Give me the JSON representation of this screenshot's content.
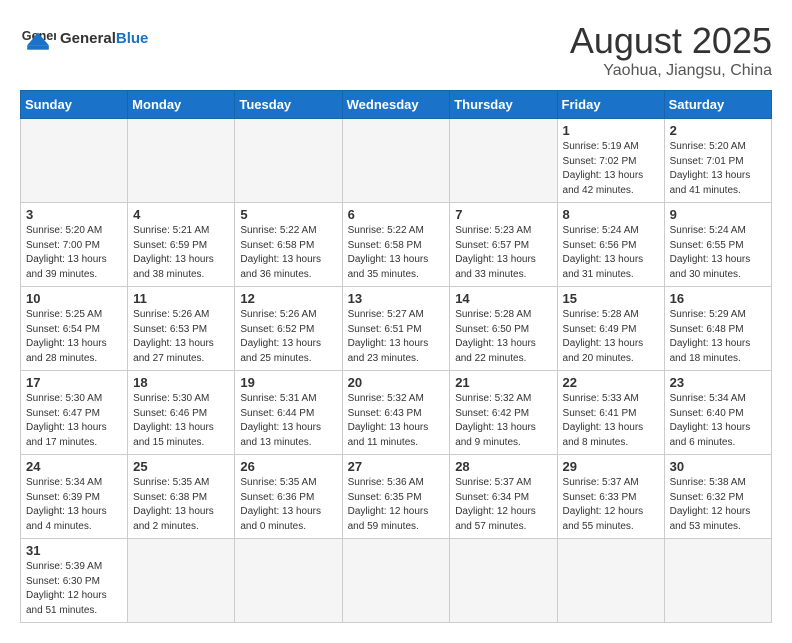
{
  "header": {
    "logo_general": "General",
    "logo_blue": "Blue",
    "month_year": "August 2025",
    "location": "Yaohua, Jiangsu, China"
  },
  "weekdays": [
    "Sunday",
    "Monday",
    "Tuesday",
    "Wednesday",
    "Thursday",
    "Friday",
    "Saturday"
  ],
  "weeks": [
    [
      {
        "day": "",
        "info": ""
      },
      {
        "day": "",
        "info": ""
      },
      {
        "day": "",
        "info": ""
      },
      {
        "day": "",
        "info": ""
      },
      {
        "day": "",
        "info": ""
      },
      {
        "day": "1",
        "info": "Sunrise: 5:19 AM\nSunset: 7:02 PM\nDaylight: 13 hours and 42 minutes."
      },
      {
        "day": "2",
        "info": "Sunrise: 5:20 AM\nSunset: 7:01 PM\nDaylight: 13 hours and 41 minutes."
      }
    ],
    [
      {
        "day": "3",
        "info": "Sunrise: 5:20 AM\nSunset: 7:00 PM\nDaylight: 13 hours and 39 minutes."
      },
      {
        "day": "4",
        "info": "Sunrise: 5:21 AM\nSunset: 6:59 PM\nDaylight: 13 hours and 38 minutes."
      },
      {
        "day": "5",
        "info": "Sunrise: 5:22 AM\nSunset: 6:58 PM\nDaylight: 13 hours and 36 minutes."
      },
      {
        "day": "6",
        "info": "Sunrise: 5:22 AM\nSunset: 6:58 PM\nDaylight: 13 hours and 35 minutes."
      },
      {
        "day": "7",
        "info": "Sunrise: 5:23 AM\nSunset: 6:57 PM\nDaylight: 13 hours and 33 minutes."
      },
      {
        "day": "8",
        "info": "Sunrise: 5:24 AM\nSunset: 6:56 PM\nDaylight: 13 hours and 31 minutes."
      },
      {
        "day": "9",
        "info": "Sunrise: 5:24 AM\nSunset: 6:55 PM\nDaylight: 13 hours and 30 minutes."
      }
    ],
    [
      {
        "day": "10",
        "info": "Sunrise: 5:25 AM\nSunset: 6:54 PM\nDaylight: 13 hours and 28 minutes."
      },
      {
        "day": "11",
        "info": "Sunrise: 5:26 AM\nSunset: 6:53 PM\nDaylight: 13 hours and 27 minutes."
      },
      {
        "day": "12",
        "info": "Sunrise: 5:26 AM\nSunset: 6:52 PM\nDaylight: 13 hours and 25 minutes."
      },
      {
        "day": "13",
        "info": "Sunrise: 5:27 AM\nSunset: 6:51 PM\nDaylight: 13 hours and 23 minutes."
      },
      {
        "day": "14",
        "info": "Sunrise: 5:28 AM\nSunset: 6:50 PM\nDaylight: 13 hours and 22 minutes."
      },
      {
        "day": "15",
        "info": "Sunrise: 5:28 AM\nSunset: 6:49 PM\nDaylight: 13 hours and 20 minutes."
      },
      {
        "day": "16",
        "info": "Sunrise: 5:29 AM\nSunset: 6:48 PM\nDaylight: 13 hours and 18 minutes."
      }
    ],
    [
      {
        "day": "17",
        "info": "Sunrise: 5:30 AM\nSunset: 6:47 PM\nDaylight: 13 hours and 17 minutes."
      },
      {
        "day": "18",
        "info": "Sunrise: 5:30 AM\nSunset: 6:46 PM\nDaylight: 13 hours and 15 minutes."
      },
      {
        "day": "19",
        "info": "Sunrise: 5:31 AM\nSunset: 6:44 PM\nDaylight: 13 hours and 13 minutes."
      },
      {
        "day": "20",
        "info": "Sunrise: 5:32 AM\nSunset: 6:43 PM\nDaylight: 13 hours and 11 minutes."
      },
      {
        "day": "21",
        "info": "Sunrise: 5:32 AM\nSunset: 6:42 PM\nDaylight: 13 hours and 9 minutes."
      },
      {
        "day": "22",
        "info": "Sunrise: 5:33 AM\nSunset: 6:41 PM\nDaylight: 13 hours and 8 minutes."
      },
      {
        "day": "23",
        "info": "Sunrise: 5:34 AM\nSunset: 6:40 PM\nDaylight: 13 hours and 6 minutes."
      }
    ],
    [
      {
        "day": "24",
        "info": "Sunrise: 5:34 AM\nSunset: 6:39 PM\nDaylight: 13 hours and 4 minutes."
      },
      {
        "day": "25",
        "info": "Sunrise: 5:35 AM\nSunset: 6:38 PM\nDaylight: 13 hours and 2 minutes."
      },
      {
        "day": "26",
        "info": "Sunrise: 5:35 AM\nSunset: 6:36 PM\nDaylight: 13 hours and 0 minutes."
      },
      {
        "day": "27",
        "info": "Sunrise: 5:36 AM\nSunset: 6:35 PM\nDaylight: 12 hours and 59 minutes."
      },
      {
        "day": "28",
        "info": "Sunrise: 5:37 AM\nSunset: 6:34 PM\nDaylight: 12 hours and 57 minutes."
      },
      {
        "day": "29",
        "info": "Sunrise: 5:37 AM\nSunset: 6:33 PM\nDaylight: 12 hours and 55 minutes."
      },
      {
        "day": "30",
        "info": "Sunrise: 5:38 AM\nSunset: 6:32 PM\nDaylight: 12 hours and 53 minutes."
      }
    ],
    [
      {
        "day": "31",
        "info": "Sunrise: 5:39 AM\nSunset: 6:30 PM\nDaylight: 12 hours and 51 minutes."
      },
      {
        "day": "",
        "info": ""
      },
      {
        "day": "",
        "info": ""
      },
      {
        "day": "",
        "info": ""
      },
      {
        "day": "",
        "info": ""
      },
      {
        "day": "",
        "info": ""
      },
      {
        "day": "",
        "info": ""
      }
    ]
  ]
}
